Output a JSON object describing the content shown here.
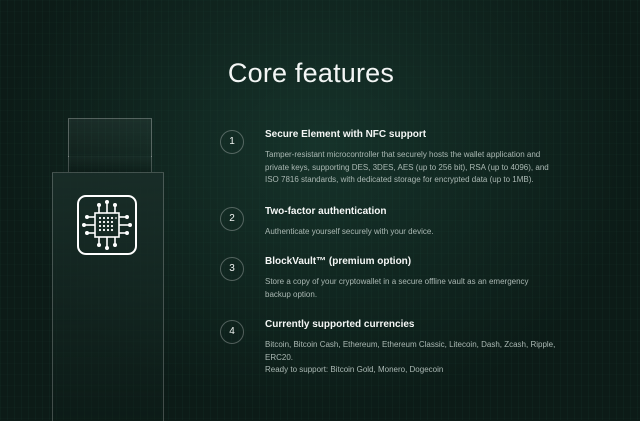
{
  "page": {
    "title": "Core features"
  },
  "features": [
    {
      "number": "1",
      "title": "Secure Element with NFC support",
      "lines": [
        "Tamper-resistant microcontroller that securely hosts the wallet application and",
        "private keys, supporting DES, 3DES, AES (up to 256 bit), RSA (up to 4096), and",
        "ISO 7816 standards, with dedicated storage for encrypted data (up to 1MB)."
      ]
    },
    {
      "number": "2",
      "title": "Two-factor authentication",
      "lines": [
        "Authenticate yourself securely with your device."
      ]
    },
    {
      "number": "3",
      "title": "BlockVault™ (premium option)",
      "lines": [
        "Store a copy of your cryptowallet in a secure offline vault as an emergency",
        "backup option."
      ]
    },
    {
      "number": "4",
      "title": "Currently supported currencies",
      "lines": [
        "Bitcoin, Bitcoin Cash, Ethereum, Ethereum Classic, Litecoin, Dash, Zcash, Ripple,",
        "ERC20.",
        "Ready to support: Bitcoin Gold, Monero, Dogecoin"
      ]
    }
  ],
  "icons": {
    "device_chip": "microchip-icon"
  },
  "colors": {
    "background": "#0c1b17",
    "accent_text": "#f5f7f6",
    "muted_text": "#aab8b3"
  }
}
